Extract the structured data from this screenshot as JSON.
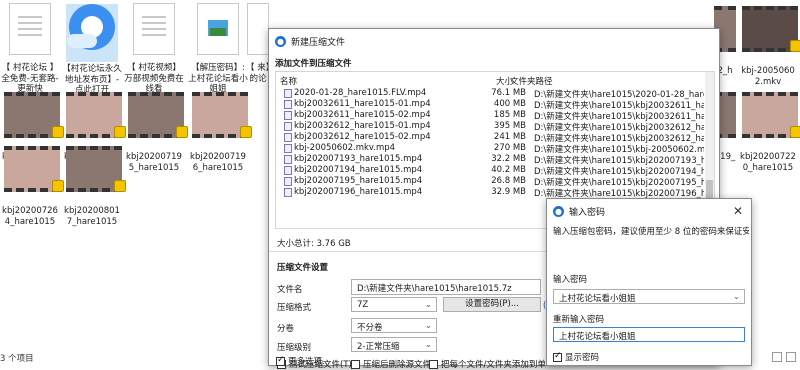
{
  "desktop": {
    "files": [
      {
        "name": "【 村花论坛 】全免费-无套路-更新快",
        "kind": "doc"
      },
      {
        "name": "【村花论坛永久地址发布页】-点此打开",
        "kind": "app"
      },
      {
        "name": "【 村花视频】万部视频免费在线看",
        "kind": "doc"
      },
      {
        "name": "【解压密码】: 上村花论坛看小姐姐",
        "kind": "img"
      },
      {
        "name": "【 来】的论",
        "kind": "doc"
      },
      {
        "name": "kbj202007193_hare1015",
        "kind": "vid"
      },
      {
        "name": "kbj202007194_hare1015",
        "kind": "vid"
      },
      {
        "name": "kbj202007195_hare1015",
        "kind": "vid"
      },
      {
        "name": "kbj202007196_hare1015",
        "kind": "vid"
      },
      {
        "name": "kbj202007264_hare1015",
        "kind": "vid"
      },
      {
        "name": "kbj202008017_hare1015",
        "kind": "vid"
      },
      {
        "name": "kbj-20050602.mkv",
        "kind": "vid"
      },
      {
        "name": "kbj202007220_hare1015",
        "kind": "vid"
      },
      {
        "name": "2_h",
        "kind": "vid"
      },
      {
        "name": "219_",
        "kind": "vid"
      }
    ],
    "status_text": "3 个项目"
  },
  "archive": {
    "title": "新建压缩文件",
    "section_add": "添加文件到压缩文件",
    "col_name": "名称",
    "col_size": "大小",
    "col_path": "文件夹路径",
    "rows": [
      {
        "name": "2020-01-28_hare1015.FLV.mp4",
        "size": "76.1 MB",
        "path": "D:\\新建文件夹\\hare1015\\2020-01-28_hare1015.F"
      },
      {
        "name": "kbj20032611_hare1015-01.mp4",
        "size": "400 MB",
        "path": "D:\\新建文件夹\\hare1015\\kbj20032611_hare1015-0"
      },
      {
        "name": "kbj20032611_hare1015-02.mp4",
        "size": "185 MB",
        "path": "D:\\新建文件夹\\hare1015\\kbj20032611_hare1015-0"
      },
      {
        "name": "kbj20032612_hare1015-01.mp4",
        "size": "395 MB",
        "path": "D:\\新建文件夹\\hare1015\\kbj20032612_hare1015-0"
      },
      {
        "name": "kbj20032612_hare1015-02.mp4",
        "size": "241 MB",
        "path": "D:\\新建文件夹\\hare1015\\kbj20032612_hare1015-0"
      },
      {
        "name": "kbj-20050602.mkv.mp4",
        "size": "270 MB",
        "path": "D:\\新建文件夹\\hare1015\\kbj-20050602.mkv.mp4"
      },
      {
        "name": "kbj202007193_hare1015.mp4",
        "size": "32.2 MB",
        "path": "D:\\新建文件夹\\hare1015\\kbj202007193_hare1015.m"
      },
      {
        "name": "kbj202007194_hare1015.mp4",
        "size": "40.2 MB",
        "path": "D:\\新建文件夹\\hare1015\\kbj202007194_hare1015.m"
      },
      {
        "name": "kbj202007195_hare1015.mp4",
        "size": "26.8 MB",
        "path": "D:\\新建文件夹\\hare1015\\kbj202007195_hare1015.m"
      },
      {
        "name": "kbj202007196_hare1015.mp4",
        "size": "32.9 MB",
        "path": "D:\\新建文件夹\\hare1015\\kbj202007196_hare1015.m"
      }
    ],
    "total_size": "大小总计: 3.76 GB",
    "section_settings": "压缩文件设置",
    "label_filename": "文件名",
    "filename_value": "D:\\新建文件夹\\hare1015\\hare1015.7z",
    "label_format": "压缩格式",
    "format_value": "7Z",
    "set_password_button": "设置密码(P)...",
    "label_volume": "分卷",
    "volume_value": "不分卷",
    "label_level": "压缩级别",
    "level_value": "2-正常压缩",
    "check_test": "测试压缩文件(T)",
    "check_delete": "压缩后删除源文件",
    "check_each": "把每个文件/文件夹添加到单独的压",
    "check_more": "更多选项...",
    "link_partial": "(A"
  },
  "password": {
    "title": "输入密码",
    "hint": "输入压缩包密码，建议使用至少 8 位的密码来保证安全性。",
    "label_enter": "输入密码",
    "value_enter": "上村花论坛看小姐姐",
    "label_reenter": "重新输入密码",
    "value_reenter": "上村花论坛看小姐姐",
    "show_password": "显示密码"
  }
}
